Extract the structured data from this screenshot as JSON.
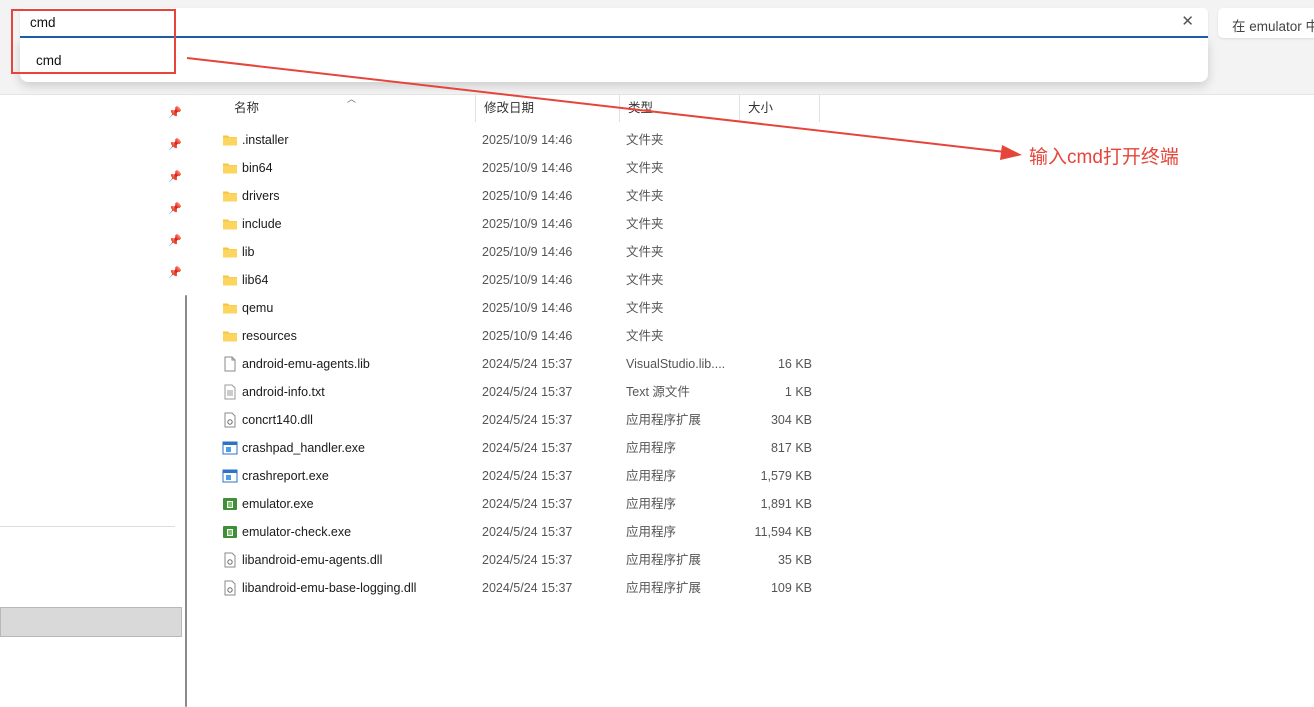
{
  "address_bar": {
    "value": "cmd",
    "clear_icon": "close-icon",
    "suggestion": "cmd"
  },
  "search_box": {
    "placeholder": "在 emulator 中"
  },
  "annotation": {
    "text": "输入cmd打开终端",
    "color": "#e5453a"
  },
  "columns": {
    "name": "名称",
    "date": "修改日期",
    "type": "类型",
    "size": "大小"
  },
  "files": [
    {
      "name": ".installer",
      "date": "2025/10/9 14:46",
      "type": "文件夹",
      "size": "",
      "icon": "folder-icon"
    },
    {
      "name": "bin64",
      "date": "2025/10/9 14:46",
      "type": "文件夹",
      "size": "",
      "icon": "folder-icon"
    },
    {
      "name": "drivers",
      "date": "2025/10/9 14:46",
      "type": "文件夹",
      "size": "",
      "icon": "folder-icon"
    },
    {
      "name": "include",
      "date": "2025/10/9 14:46",
      "type": "文件夹",
      "size": "",
      "icon": "folder-icon"
    },
    {
      "name": "lib",
      "date": "2025/10/9 14:46",
      "type": "文件夹",
      "size": "",
      "icon": "folder-icon"
    },
    {
      "name": "lib64",
      "date": "2025/10/9 14:46",
      "type": "文件夹",
      "size": "",
      "icon": "folder-icon"
    },
    {
      "name": "qemu",
      "date": "2025/10/9 14:46",
      "type": "文件夹",
      "size": "",
      "icon": "folder-icon"
    },
    {
      "name": "resources",
      "date": "2025/10/9 14:46",
      "type": "文件夹",
      "size": "",
      "icon": "folder-icon"
    },
    {
      "name": "android-emu-agents.lib",
      "date": "2024/5/24 15:37",
      "type": "VisualStudio.lib....",
      "size": "16 KB",
      "icon": "file-icon"
    },
    {
      "name": "android-info.txt",
      "date": "2024/5/24 15:37",
      "type": "Text 源文件",
      "size": "1 KB",
      "icon": "text-file-icon"
    },
    {
      "name": "concrt140.dll",
      "date": "2024/5/24 15:37",
      "type": "应用程序扩展",
      "size": "304 KB",
      "icon": "dll-icon"
    },
    {
      "name": "crashpad_handler.exe",
      "date": "2024/5/24 15:37",
      "type": "应用程序",
      "size": "817 KB",
      "icon": "exe-icon"
    },
    {
      "name": "crashreport.exe",
      "date": "2024/5/24 15:37",
      "type": "应用程序",
      "size": "1,579 KB",
      "icon": "exe-icon"
    },
    {
      "name": "emulator.exe",
      "date": "2024/5/24 15:37",
      "type": "应用程序",
      "size": "1,891 KB",
      "icon": "android-exe-icon"
    },
    {
      "name": "emulator-check.exe",
      "date": "2024/5/24 15:37",
      "type": "应用程序",
      "size": "11,594 KB",
      "icon": "android-exe-icon"
    },
    {
      "name": "libandroid-emu-agents.dll",
      "date": "2024/5/24 15:37",
      "type": "应用程序扩展",
      "size": "35 KB",
      "icon": "dll-icon"
    },
    {
      "name": "libandroid-emu-base-logging.dll",
      "date": "2024/5/24 15:37",
      "type": "应用程序扩展",
      "size": "109 KB",
      "icon": "dll-icon"
    }
  ],
  "sidebar": {
    "pin_icon": "pin-icon"
  }
}
